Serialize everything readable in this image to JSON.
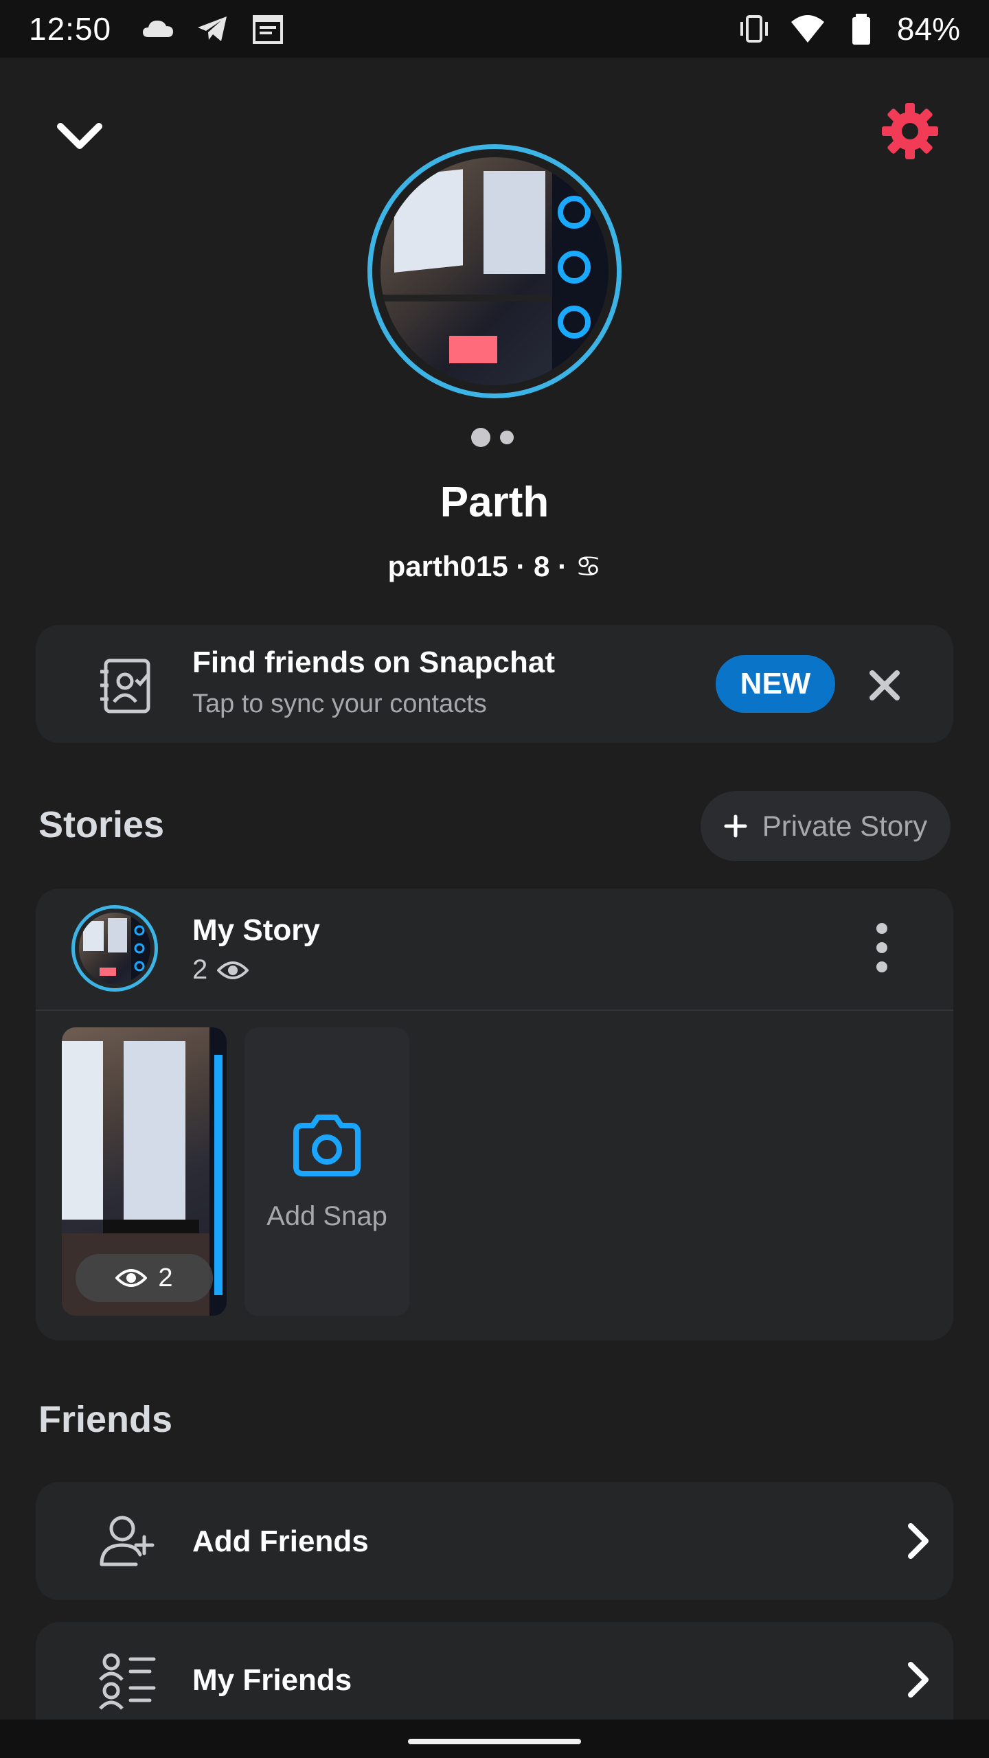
{
  "status_bar": {
    "time": "12:50",
    "battery_percent": "84%",
    "left_icons": [
      "cloud-icon",
      "telegram-icon",
      "calendar-icon"
    ],
    "right_icons": [
      "vibrate-icon",
      "wifi-icon",
      "battery-icon"
    ]
  },
  "profile": {
    "name": "Parth",
    "username_line": "parth015 · 8 · ♋",
    "avatar_pages": 2
  },
  "find_friends": {
    "title": "Find friends on Snapchat",
    "subtitle": "Tap to sync your contacts",
    "badge": "NEW"
  },
  "stories": {
    "section_title": "Stories",
    "private_story_label": "Private Story",
    "my_story": {
      "title": "My Story",
      "views": "2"
    },
    "snap_views": "2",
    "add_snap_label": "Add Snap"
  },
  "friends": {
    "section_title": "Friends",
    "items": [
      {
        "label": "Add Friends",
        "icon": "add-person-icon"
      },
      {
        "label": "My Friends",
        "icon": "friends-list-icon"
      }
    ]
  },
  "colors": {
    "background": "#1e1e1f",
    "card": "#252628",
    "accent_blue": "#3cb4e6",
    "badge_blue": "#0a74c9",
    "settings_red": "#f23c57"
  }
}
